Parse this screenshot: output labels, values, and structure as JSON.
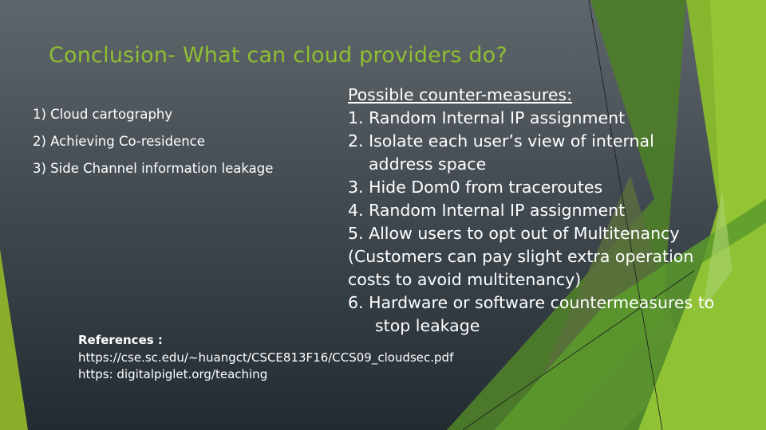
{
  "slide": {
    "title": "Conclusion- What can cloud providers do?",
    "colors": {
      "title": "#8fbf32",
      "background_top": "#5f666b",
      "background_bottom": "#232b32",
      "accent_green_light": "#94c23a",
      "accent_green_dark": "#4e7f2a"
    },
    "left_list": [
      "1) Cloud cartography",
      "2) Achieving Co-residence",
      "3) Side Channel information leakage"
    ],
    "countermeasures": {
      "heading": "Possible counter-measures:",
      "lines": [
        "1. Random Internal IP assignment",
        "2. Isolate each user’s view of internal",
        "address space",
        "3. Hide Dom0 from traceroutes",
        "4. Random Internal IP assignment",
        "5. Allow users to opt out of Multitenancy",
        "(Customers can pay slight extra operation",
        "costs to avoid multitenancy)",
        "6. Hardware or software countermeasures to",
        "stop leakage"
      ]
    },
    "references": {
      "heading": "References :",
      "links": [
        "https://cse.sc.edu/~huangct/CSCE813F16/CCS09_cloudsec.pdf",
        "https: digitalpiglet.org/teaching"
      ]
    }
  }
}
